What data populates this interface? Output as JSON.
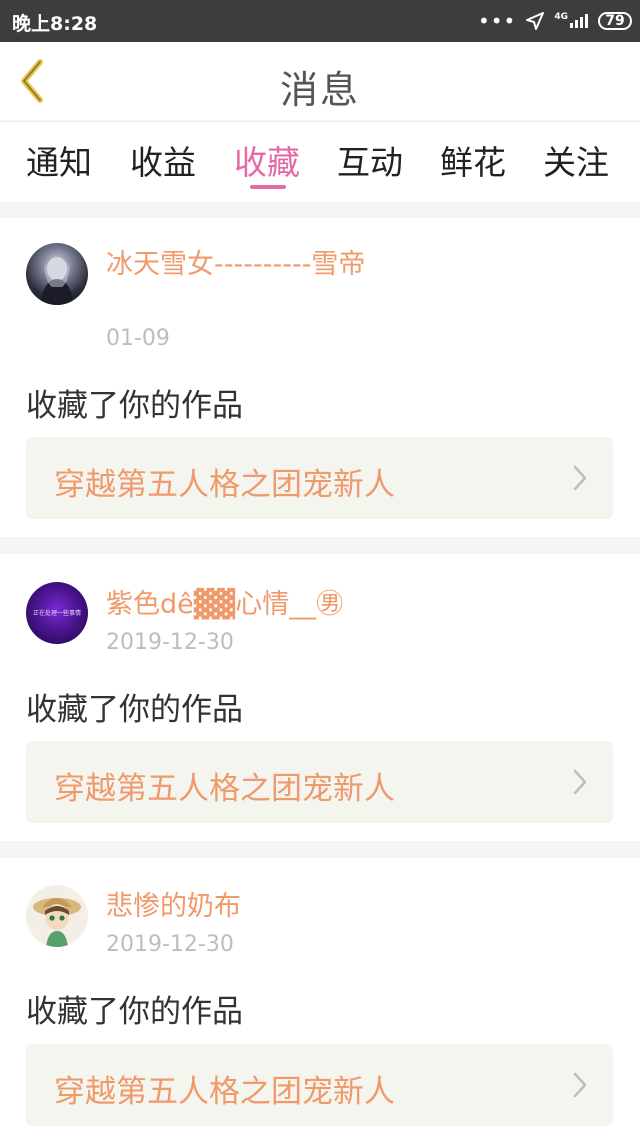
{
  "status_bar": {
    "time": "晚上8:28",
    "dots": "•••",
    "network": "4G",
    "battery": "79"
  },
  "header": {
    "title": "消息",
    "back_icon": "chevron-left-icon"
  },
  "tabs": [
    {
      "label": "通知",
      "active": false
    },
    {
      "label": "收益",
      "active": false
    },
    {
      "label": "收藏",
      "active": true
    },
    {
      "label": "互动",
      "active": false
    },
    {
      "label": "鲜花",
      "active": false
    },
    {
      "label": "关注",
      "active": false
    }
  ],
  "colors": {
    "accent": "#e46aa7",
    "name": "#f09a6b",
    "date": "#bdbdbd",
    "work_bg": "#f5f5f0"
  },
  "items": [
    {
      "username": "冰天雪女----------雪帝",
      "date": "01-09",
      "action": "收藏了你的作品",
      "work_title": "穿越第五人格之团宠新人"
    },
    {
      "username": "紫色dê▓▓心情__㊚",
      "date": "2019-12-30",
      "action": "收藏了你的作品",
      "work_title": "穿越第五人格之团宠新人",
      "avatar_text": "正在处理一些事情"
    },
    {
      "username": "悲惨的奶布",
      "date": "2019-12-30",
      "action": "收藏了你的作品",
      "work_title": "穿越第五人格之团宠新人"
    }
  ]
}
